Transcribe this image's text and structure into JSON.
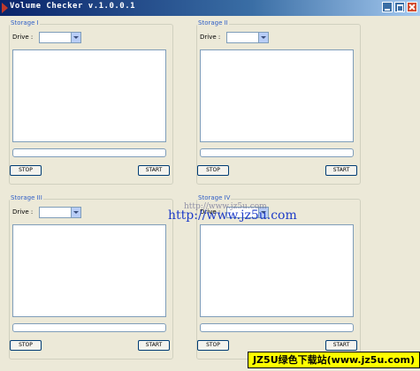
{
  "window": {
    "title": "Volume Checker v.1.0.0.1"
  },
  "groups": [
    {
      "title": "Storage I",
      "drive_label": "Drive :",
      "drive_value": "",
      "progress": 0,
      "stop_label": "STOP",
      "start_label": "START"
    },
    {
      "title": "Storage II",
      "drive_label": "Drive :",
      "drive_value": "",
      "progress": 0,
      "stop_label": "STOP",
      "start_label": "START"
    },
    {
      "title": "Storage III",
      "drive_label": "Drive :",
      "drive_value": "",
      "progress": 0,
      "stop_label": "STOP",
      "start_label": "START"
    },
    {
      "title": "Storage IV",
      "drive_label": "Drive :",
      "drive_value": "",
      "progress": 0,
      "stop_label": "STOP",
      "start_label": "START"
    }
  ],
  "watermark": {
    "url_large": "http://www.jz5u.com",
    "url_small": "http://www.jz5u.com",
    "banner": "JZ5U绿色下载站(www.jz5u.com)"
  },
  "colors": {
    "titlebar": "#0A246A",
    "group_title": "#2F5EC6",
    "banner_bg": "#FFFF00",
    "watermark_text": "#1E3CC8"
  }
}
